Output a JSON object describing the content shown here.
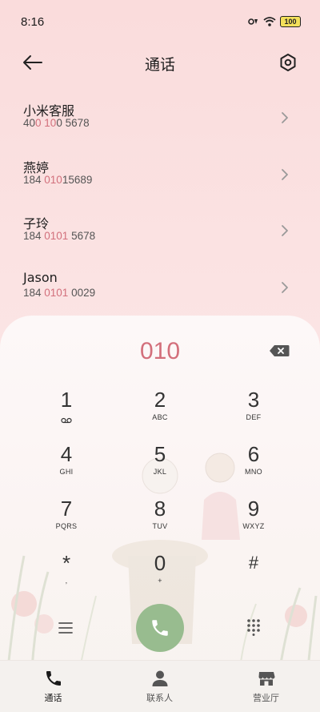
{
  "status_bar": {
    "time": "8:16",
    "battery": "100"
  },
  "header": {
    "title": "通话",
    "back_icon": "arrow-left-icon",
    "settings_icon": "hexagon-gear-icon"
  },
  "matches": [
    {
      "name": "小米客服",
      "number_pre": "40",
      "number_hl": "0 10",
      "number_post": "0 5678"
    },
    {
      "name": "燕婷",
      "number_pre": "184 ",
      "number_hl": "010",
      "number_post": "15689"
    },
    {
      "name": "子玲",
      "number_pre": "184 ",
      "number_hl": "0101",
      "number_post": " 5678"
    },
    {
      "name": "Jason",
      "number_pre": "184 ",
      "number_hl": "0101",
      "number_post": " 0029"
    }
  ],
  "dialpad": {
    "input": "010",
    "keys": [
      {
        "digit": "1",
        "letters": ""
      },
      {
        "digit": "2",
        "letters": "ABC"
      },
      {
        "digit": "3",
        "letters": "DEF"
      },
      {
        "digit": "4",
        "letters": "GHI"
      },
      {
        "digit": "5",
        "letters": "JKL"
      },
      {
        "digit": "6",
        "letters": "MNO"
      },
      {
        "digit": "7",
        "letters": "PQRS"
      },
      {
        "digit": "8",
        "letters": "TUV"
      },
      {
        "digit": "9",
        "letters": "WXYZ"
      },
      {
        "digit": "*",
        "letters": ","
      },
      {
        "digit": "0",
        "letters": "+"
      },
      {
        "digit": "#",
        "letters": ""
      }
    ]
  },
  "bottom_nav": [
    {
      "label": "通话",
      "icon": "phone-icon",
      "active": true
    },
    {
      "label": "联系人",
      "icon": "person-icon",
      "active": false
    },
    {
      "label": "营业厅",
      "icon": "store-icon",
      "active": false
    }
  ],
  "colors": {
    "accent": "#d36f7b",
    "call_button": "#98bc8f",
    "background_top": "#fadcdc"
  }
}
